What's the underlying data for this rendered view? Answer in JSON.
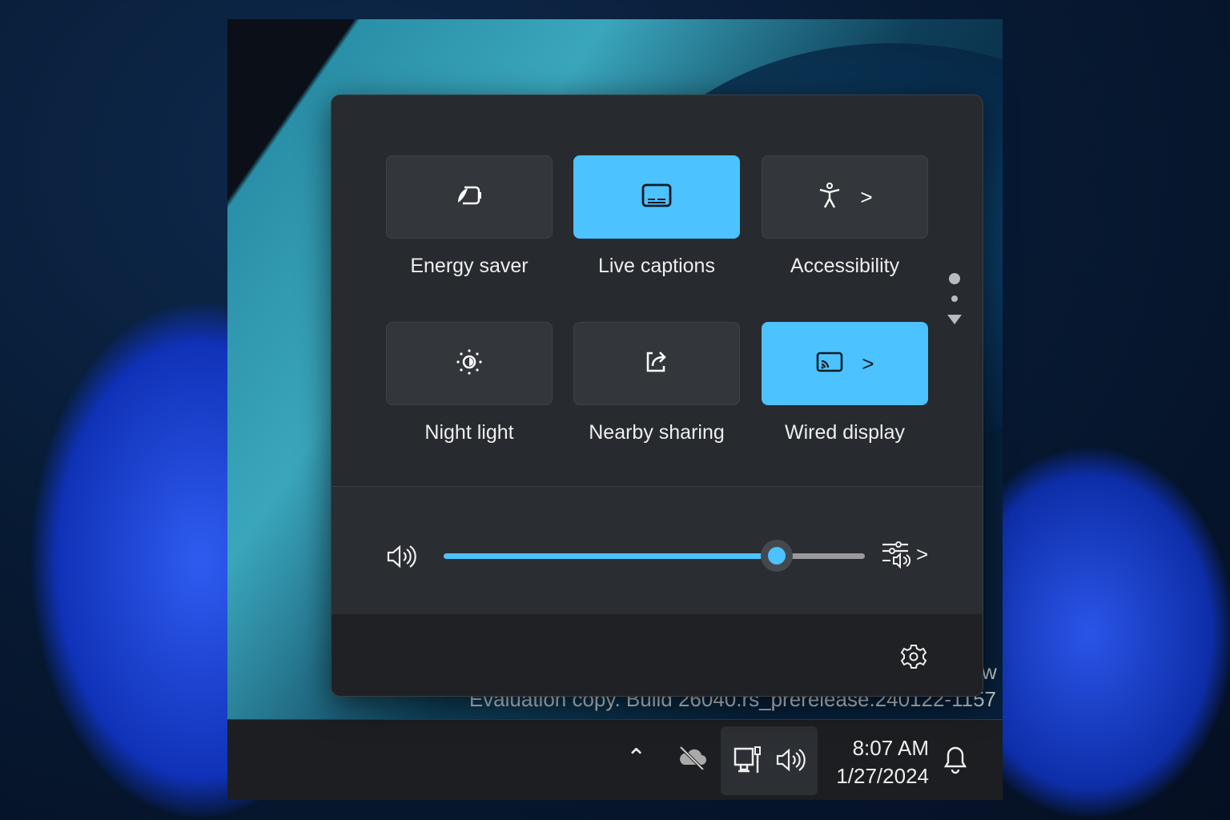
{
  "quick_settings": {
    "tiles": [
      {
        "label": "Energy saver",
        "icon": "energy-saver-icon",
        "active": false,
        "has_chevron": false
      },
      {
        "label": "Live captions",
        "icon": "live-captions-icon",
        "active": true,
        "has_chevron": false
      },
      {
        "label": "Accessibility",
        "icon": "accessibility-icon",
        "active": false,
        "has_chevron": true
      },
      {
        "label": "Night light",
        "icon": "night-light-icon",
        "active": false,
        "has_chevron": false
      },
      {
        "label": "Nearby sharing",
        "icon": "nearby-sharing-icon",
        "active": false,
        "has_chevron": false
      },
      {
        "label": "Wired display",
        "icon": "cast-icon",
        "active": true,
        "has_chevron": true
      }
    ],
    "chevron": ">",
    "page_count": 2,
    "current_page": 1,
    "volume_percent": 79,
    "accent_color": "#4cc2ff"
  },
  "watermark": {
    "line1_partial": "w",
    "line2": "Evaluation copy. Build 26040.rs_prerelease.240122-1157"
  },
  "taskbar": {
    "time": "8:07 AM",
    "date": "1/27/2024"
  }
}
